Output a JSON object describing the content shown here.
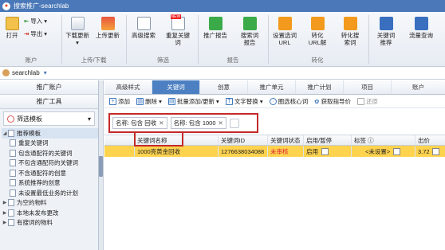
{
  "window": {
    "title": "搜索推广-searchlab"
  },
  "ribbon": {
    "buttons": [
      {
        "label": "打开"
      },
      {
        "label": "导入"
      },
      {
        "label": "导出"
      },
      {
        "label": "下载更新"
      },
      {
        "label": "上传更新"
      },
      {
        "label": "高级搜索"
      },
      {
        "label": "重复关键词"
      },
      {
        "label": "推广报告"
      },
      {
        "label": "搜索词报告"
      },
      {
        "label": "设置选词URL"
      },
      {
        "label": "转化URL解"
      },
      {
        "label": "转化搜索词"
      },
      {
        "label": "关键词推荐"
      },
      {
        "label": "流量查询"
      }
    ],
    "new_badge": "NEW",
    "groups": [
      "账户",
      "上传/下载",
      "筛选",
      "报告",
      "转化"
    ]
  },
  "account": {
    "name": "searchlab"
  },
  "left": {
    "header1": "推广账户",
    "header2": "推广工具",
    "dropdown": "筛选模板",
    "tree_root": "推荐模板",
    "items": [
      "重复关键词",
      "包含通配符的关键词",
      "不包含通配符的关键词",
      "不含通配符的创意",
      "系统推荐的创意",
      "未设置最低业务的计划",
      "为空的物料",
      "本地未发布更改",
      "有搜词的物料"
    ]
  },
  "tabs": [
    "高级样式",
    "关键词",
    "创意",
    "推广单元",
    "推广计划",
    "项目",
    "账户"
  ],
  "active_tab": "关键词",
  "toolbar": {
    "add": "添加",
    "delete": "删除",
    "batch": "批量添加/更新",
    "replace": "文字替换",
    "core": "圈选核心词",
    "bid": "获取指导价",
    "restore": "还原"
  },
  "filters": [
    "名称: 包含 回收",
    "名称: 包含 1000"
  ],
  "table": {
    "headers": [
      "关键词名称",
      "关键词ID",
      "关键词状态",
      "启用/暂停",
      "标签",
      "出价"
    ],
    "rows": [
      {
        "name": "1000亮黄金回收",
        "id": "1276638034088",
        "status": "未审核",
        "enabled": "启用",
        "tag": "<未设置>",
        "bid": "3.72"
      }
    ]
  },
  "colors": {
    "titlebar": "#4a78b8",
    "active_tab": "#4c80c2",
    "highlight_row": "#ffd34e",
    "annotation_box": "#c22a2a"
  }
}
